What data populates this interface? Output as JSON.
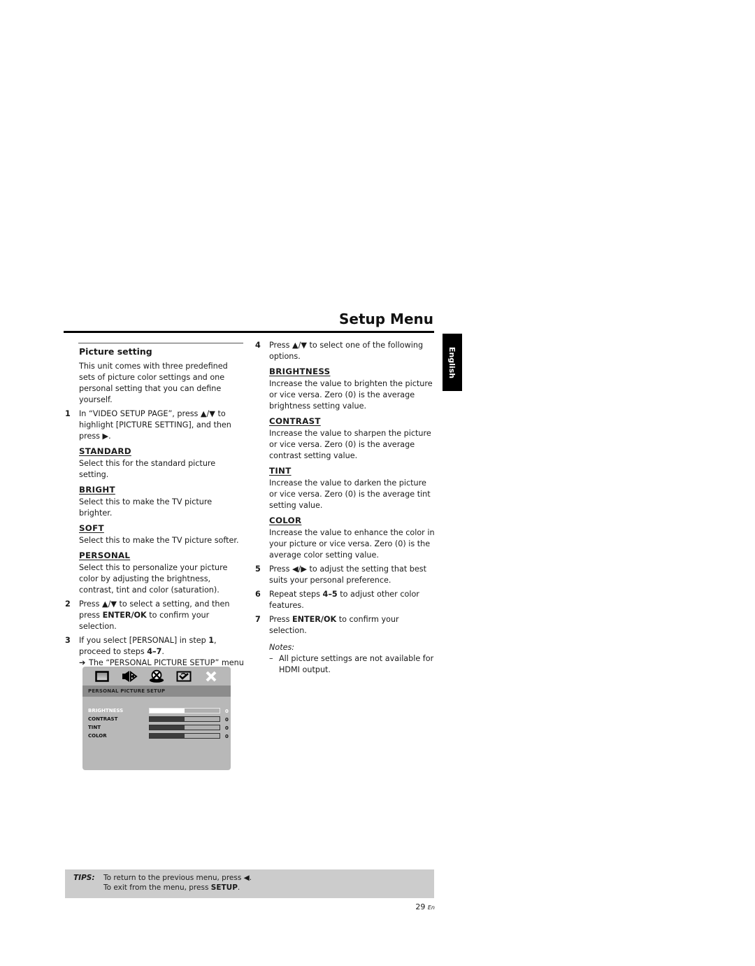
{
  "header": {
    "title": "Setup Menu",
    "language_tab": "English"
  },
  "left_column": {
    "section_title": "Picture setting",
    "intro": "This unit comes with three predefined sets of picture color settings and one personal setting that you can define yourself.",
    "step1": {
      "num": "1",
      "text_a": "In “VIDEO SETUP PAGE”, press ▲/▼ to highlight [PICTURE SETTING], and then press ▶."
    },
    "options": [
      {
        "heading": "STANDARD",
        "text": "Select this for the standard picture setting."
      },
      {
        "heading": "BRIGHT",
        "text": "Select this to make the TV picture brighter."
      },
      {
        "heading": "SOFT",
        "text": "Select this to make the TV picture softer."
      },
      {
        "heading": "PERSONAL",
        "text": "Select this to personalize your picture color by adjusting the brightness, contrast, tint and color (saturation)."
      }
    ],
    "step2": {
      "num": "2",
      "pre": "Press ▲/▼ to select a setting, and then press ",
      "bold": "ENTER/OK",
      "post": " to confirm your selection."
    },
    "step3": {
      "num": "3",
      "pre": "If you select [PERSONAL] in step ",
      "bold1": "1",
      "mid": ", proceed to steps ",
      "bold2": "4–7",
      "post": ".",
      "arrow": "➔",
      "result": "The “PERSONAL PICTURE SETUP” menu appears."
    }
  },
  "osd_menu": {
    "icons": [
      "tv-screen-icon",
      "speaker-audio-icon",
      "disc-icon",
      "preference-checkmark-icon",
      "close-icon"
    ],
    "header": "PERSONAL PICTURE SETUP",
    "rows": [
      {
        "label": "BRIGHTNESS",
        "value": "0",
        "level": 0.5,
        "active": true
      },
      {
        "label": "CONTRAST",
        "value": "0",
        "level": 0.5,
        "active": false
      },
      {
        "label": "TINT",
        "value": "0",
        "level": 0.5,
        "active": false
      },
      {
        "label": "COLOR",
        "value": "0",
        "level": 0.5,
        "active": false
      }
    ]
  },
  "right_column": {
    "step4": {
      "num": "4",
      "text": "Press ▲/▼ to select one of the following options."
    },
    "options": [
      {
        "heading": "BRIGHTNESS",
        "text": "Increase the value to brighten the picture or vice versa. Zero (0) is the average brightness setting value."
      },
      {
        "heading": "CONTRAST",
        "text": "Increase the value to sharpen the picture or vice versa. Zero (0) is the average contrast setting value."
      },
      {
        "heading": "TINT",
        "text": "Increase the value to darken the picture or vice versa. Zero (0) is the average tint setting value."
      },
      {
        "heading": "COLOR",
        "text": "Increase the value to enhance the color in your picture or vice versa. Zero (0) is the average color setting value."
      }
    ],
    "step5": {
      "num": "5",
      "text": "Press ◀/▶ to adjust the setting that best suits your personal preference."
    },
    "step6": {
      "num": "6",
      "pre": "Repeat steps ",
      "bold": "4–5",
      "post": " to adjust other color features."
    },
    "step7": {
      "num": "7",
      "pre": "Press ",
      "bold": "ENTER/OK",
      "post": " to confirm your selection."
    },
    "notes": {
      "label": "Notes:",
      "dash": "–",
      "items": [
        "All picture settings are not available for HDMI output."
      ]
    }
  },
  "tips": {
    "label": "TIPS:",
    "line1": "To return to the previous menu, press ◀.",
    "line2_pre": "To exit from the menu, press ",
    "line2_bold": "SETUP",
    "line2_post": "."
  },
  "footer": {
    "page_number": "29",
    "lang_suffix": "En"
  }
}
